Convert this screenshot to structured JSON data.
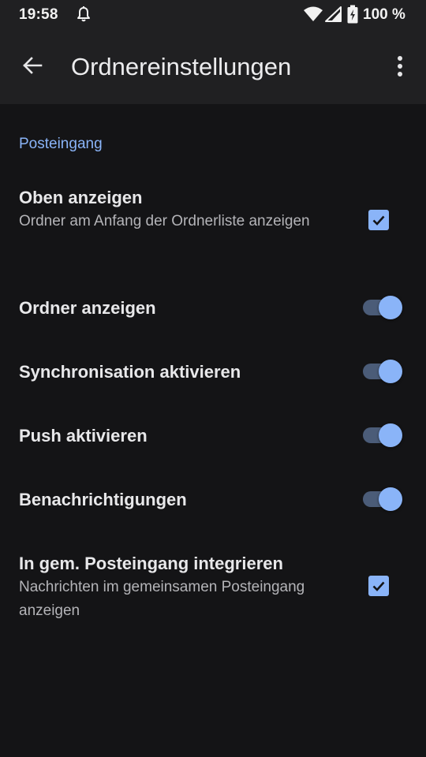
{
  "status_bar": {
    "time": "19:58",
    "battery": "100 %",
    "icons": [
      "bell-icon",
      "wifi-icon",
      "signal-icon",
      "battery-icon"
    ]
  },
  "app_bar": {
    "title": "Ordnereinstellungen",
    "back_icon": "arrow-back-icon",
    "menu_icon": "more-vert-icon"
  },
  "section": {
    "header": "Posteingang"
  },
  "preferences": [
    {
      "title": "Oben anzeigen",
      "summary": "Ordner am Anfang der Ordnerliste anzeigen",
      "control": "checkbox",
      "checked": true
    },
    {
      "title": "Ordner anzeigen",
      "control": "switch",
      "checked": true
    },
    {
      "title": "Synchronisation aktivieren",
      "control": "switch",
      "checked": true
    },
    {
      "title": "Push aktivieren",
      "control": "switch",
      "checked": true
    },
    {
      "title": "Benachrichtigungen",
      "control": "switch",
      "checked": true
    },
    {
      "title": "In gem. Posteingang integrieren",
      "summary": "Nachrichten im gemeinsamen Posteingang anzeigen",
      "control": "checkbox",
      "checked": true
    }
  ],
  "colors": {
    "accent": "#8ab4f8",
    "background": "#141416",
    "app_bar": "#202022",
    "switch_track": "#4b5c78"
  }
}
